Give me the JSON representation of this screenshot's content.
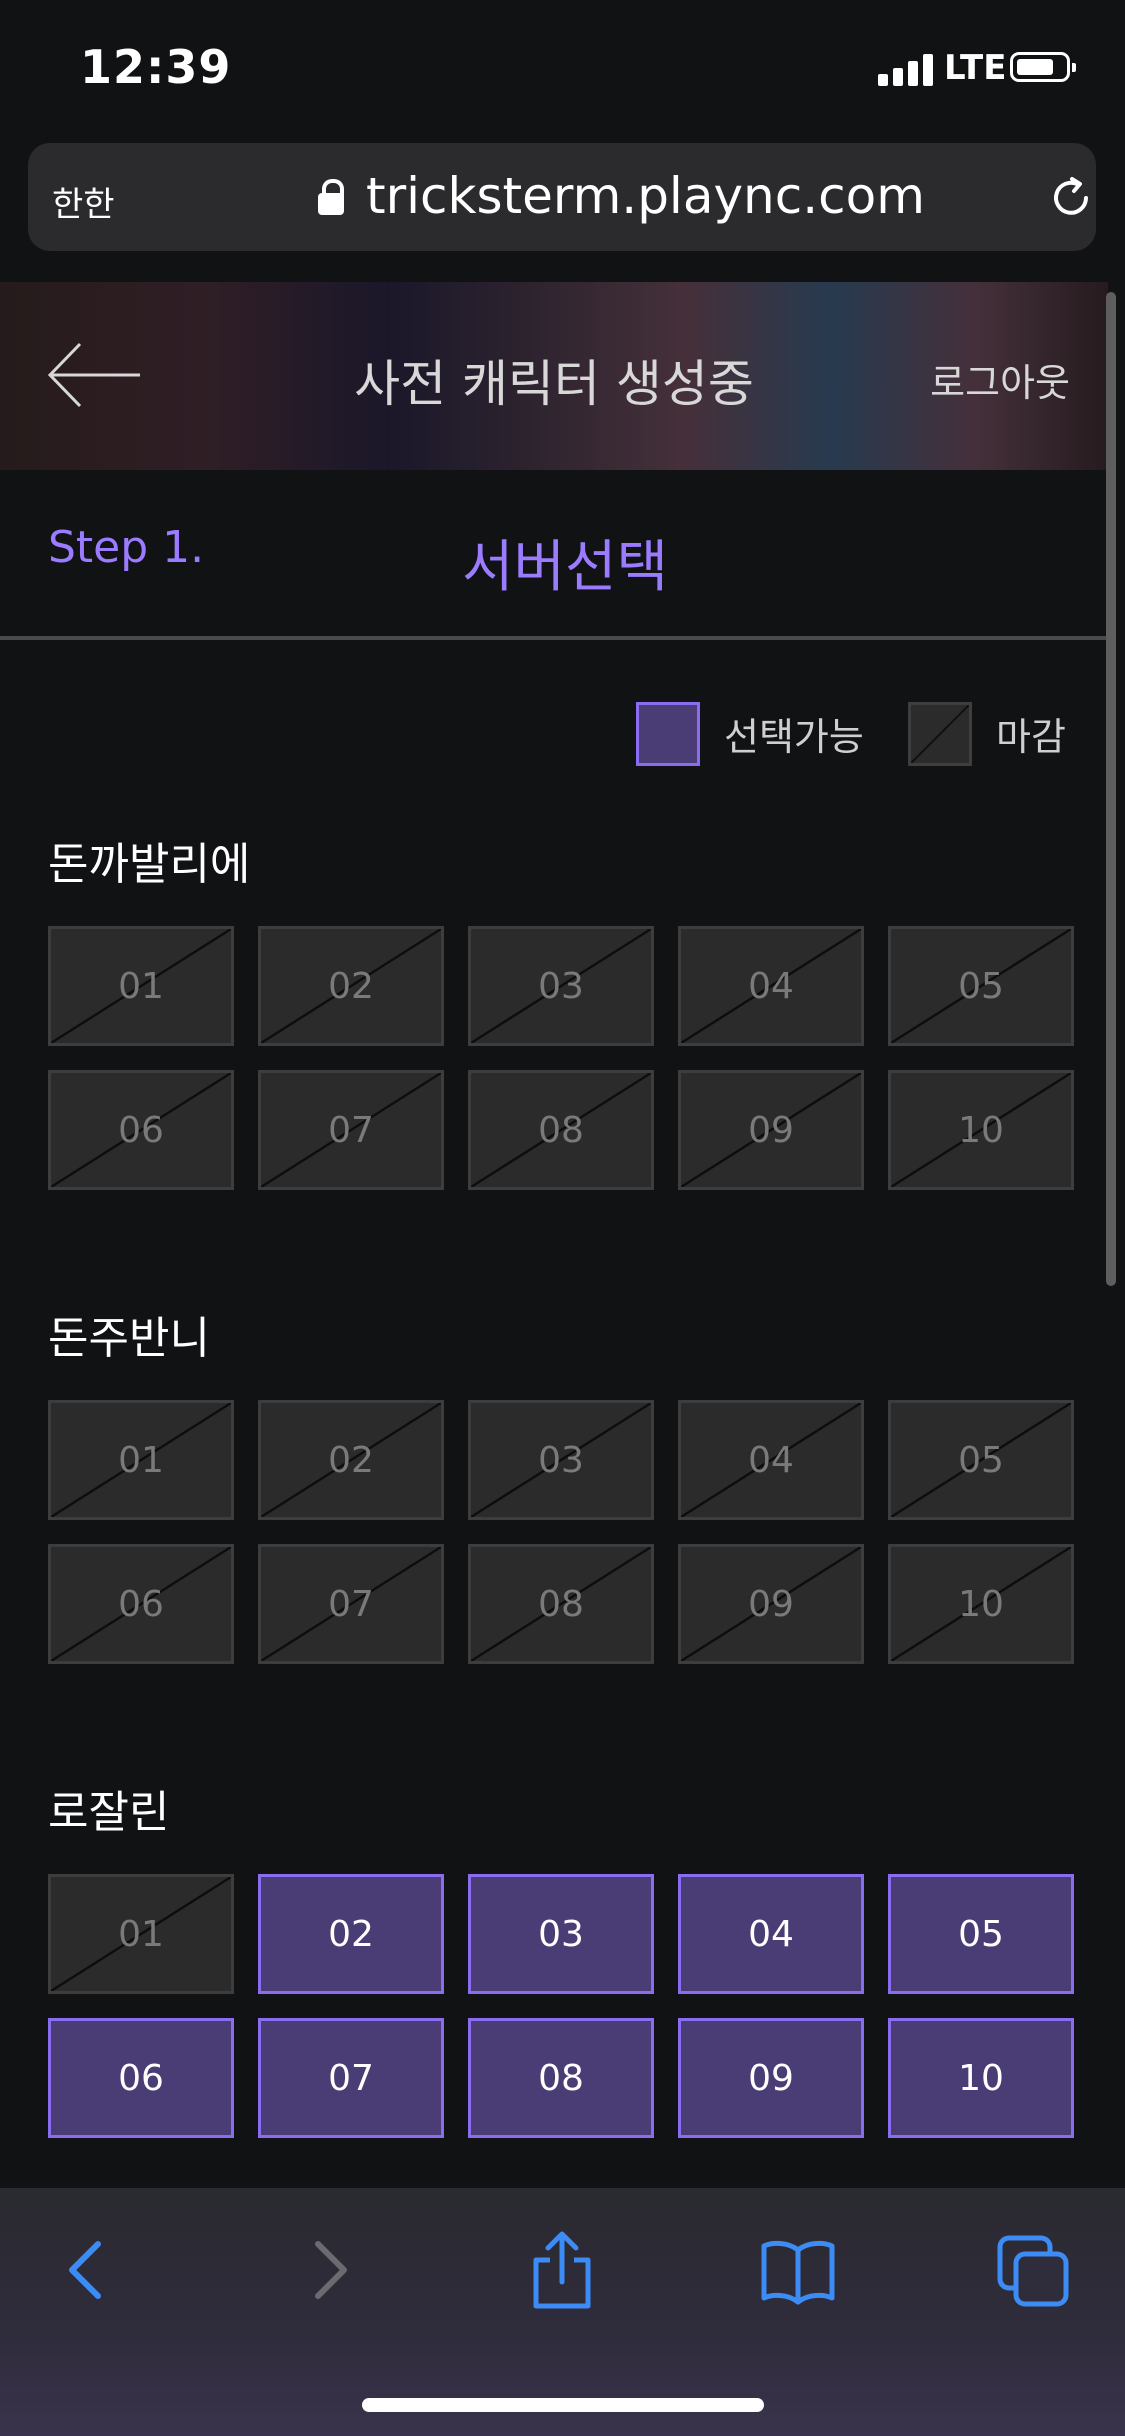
{
  "status": {
    "time": "12:39",
    "network": "LTE"
  },
  "browser": {
    "text_size_label": "한한",
    "url": "tricksterm.plaync.com"
  },
  "header": {
    "title": "사전 캐릭터 생성중",
    "logout_label": "로그아웃"
  },
  "step": {
    "label": "Step 1.",
    "title": "서버선택"
  },
  "legend": {
    "available_label": "선택가능",
    "closed_label": "마감"
  },
  "servers": [
    {
      "name": "돈까발리에",
      "channels": [
        {
          "num": "01",
          "status": "closed"
        },
        {
          "num": "02",
          "status": "closed"
        },
        {
          "num": "03",
          "status": "closed"
        },
        {
          "num": "04",
          "status": "closed"
        },
        {
          "num": "05",
          "status": "closed"
        },
        {
          "num": "06",
          "status": "closed"
        },
        {
          "num": "07",
          "status": "closed"
        },
        {
          "num": "08",
          "status": "closed"
        },
        {
          "num": "09",
          "status": "closed"
        },
        {
          "num": "10",
          "status": "closed"
        }
      ]
    },
    {
      "name": "돈주반니",
      "channels": [
        {
          "num": "01",
          "status": "closed"
        },
        {
          "num": "02",
          "status": "closed"
        },
        {
          "num": "03",
          "status": "closed"
        },
        {
          "num": "04",
          "status": "closed"
        },
        {
          "num": "05",
          "status": "closed"
        },
        {
          "num": "06",
          "status": "closed"
        },
        {
          "num": "07",
          "status": "closed"
        },
        {
          "num": "08",
          "status": "closed"
        },
        {
          "num": "09",
          "status": "closed"
        },
        {
          "num": "10",
          "status": "closed"
        }
      ]
    },
    {
      "name": "로잘린",
      "channels": [
        {
          "num": "01",
          "status": "closed"
        },
        {
          "num": "02",
          "status": "available"
        },
        {
          "num": "03",
          "status": "available"
        },
        {
          "num": "04",
          "status": "available"
        },
        {
          "num": "05",
          "status": "available"
        },
        {
          "num": "06",
          "status": "available"
        },
        {
          "num": "07",
          "status": "available"
        },
        {
          "num": "08",
          "status": "available"
        },
        {
          "num": "09",
          "status": "available"
        },
        {
          "num": "10",
          "status": "available"
        }
      ]
    }
  ],
  "colors": {
    "accent": "#9b7bff",
    "available_fill": "#4a3c75",
    "available_border": "#8a6cf0",
    "closed_fill": "#2b2b2b",
    "toolbar_icon": "#3d8bf5"
  }
}
